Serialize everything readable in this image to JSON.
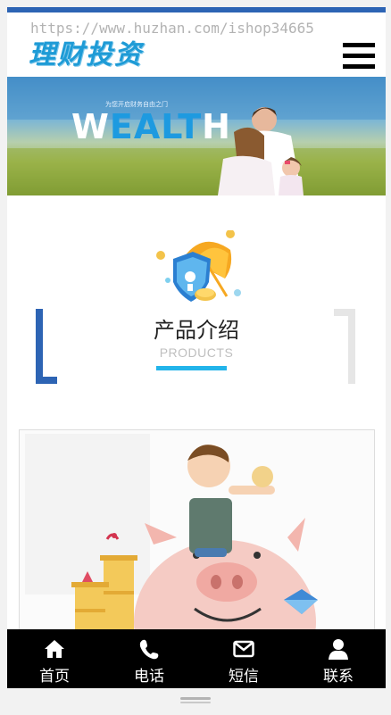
{
  "header": {
    "logo_text": "理财投资",
    "watermark": "https://www.huzhan.com/ishop34665",
    "menu_icon": "hamburger-menu-icon"
  },
  "banner": {
    "slogan": "为您开启财务自由之门",
    "word_part1": "W",
    "word_part2": "EALT",
    "word_part3": "H"
  },
  "section": {
    "icon": "umbrella-shield-coin-icon",
    "title": "产品介绍",
    "subtitle": "PRODUCTS"
  },
  "product": {
    "image": "piggy-bank-illustration"
  },
  "bottom_nav": {
    "items": [
      {
        "label": "首页",
        "icon": "home-icon"
      },
      {
        "label": "电话",
        "icon": "phone-icon"
      },
      {
        "label": "短信",
        "icon": "mail-icon"
      },
      {
        "label": "联系",
        "icon": "user-icon"
      }
    ]
  },
  "colors": {
    "accent_blue": "#2d64b4",
    "title_underline": "#22b4ea",
    "logo": "#1e9bd6",
    "nav_bg": "#000000"
  }
}
